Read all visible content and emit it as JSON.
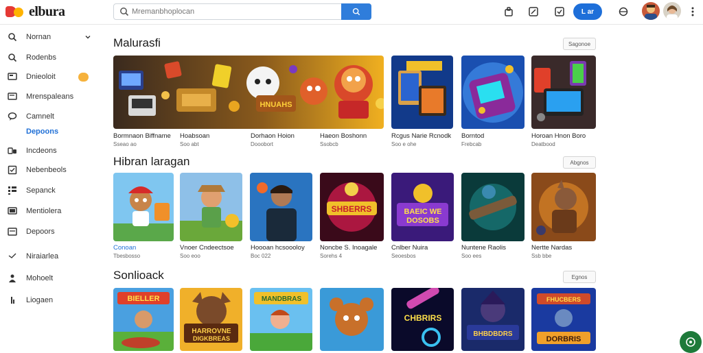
{
  "header": {
    "logo_text": "elbura",
    "search_placeholder": "Mremanbhoplocan",
    "pill_label": "L ar"
  },
  "sidebar": {
    "items": [
      {
        "label": "Nornan",
        "icon": "search-icon"
      },
      {
        "label": "Rodenbs",
        "icon": "gear-icon"
      },
      {
        "label": "Dnieoloit",
        "icon": "monitor-icon"
      },
      {
        "label": "Mrenspaleans",
        "icon": "monitor-icon"
      },
      {
        "label": "Camnelt",
        "icon": "chat-icon"
      },
      {
        "label": "Depoons",
        "icon": ""
      },
      {
        "label": "Incdeons",
        "icon": "sliders-icon"
      },
      {
        "label": "Nebenbeols",
        "icon": "checkbox-icon"
      },
      {
        "label": "Sepanck",
        "icon": "grid-icon"
      },
      {
        "label": "Mentiolera",
        "icon": "monitor-icon"
      },
      {
        "label": "Depoors",
        "icon": "list-icon"
      },
      {
        "label": "Niraiarlea",
        "icon": "signal-icon"
      },
      {
        "label": "Mohoelt",
        "icon": "user-icon"
      },
      {
        "label": "Liogaen",
        "icon": "bars-icon"
      }
    ]
  },
  "sections": [
    {
      "title": "Malurasfi",
      "see_all": "Sagonoe",
      "tiles": [
        {
          "name": "Bormnaon Biffname",
          "sub": "Sseao ao"
        },
        {
          "name": "Hoabsoan",
          "sub": "Soo abt"
        },
        {
          "name": "Dorhaon Hoion",
          "sub": "Dooobort"
        },
        {
          "name": "Haeon Boshonn",
          "sub": "Ssobcb"
        },
        {
          "name": "Rcgus Narie Rcnodk",
          "sub": "Soo e ohe"
        },
        {
          "name": "Borntod",
          "sub": "Frebcab"
        },
        {
          "name": "Horoan Hnon Boro",
          "sub": "Deatbood"
        }
      ]
    },
    {
      "title": "Hibran laragan",
      "see_all": "Abgnos",
      "tiles": [
        {
          "name": "Conoan",
          "sub": "Tbesbosso"
        },
        {
          "name": "Vnoer Cndeectsoe",
          "sub": "Soo eoo"
        },
        {
          "name": "Hoooan hcsoooloy",
          "sub": "Boc 022"
        },
        {
          "name": "Noncbe S. Inoagale",
          "sub": "Sorehs 4"
        },
        {
          "name": "Cnlber Nuira",
          "sub": "Seoesbos"
        },
        {
          "name": "Nuntene Raolis",
          "sub": "Soo ees"
        },
        {
          "name": "Nertte Nardas",
          "sub": "Ssb bbe"
        }
      ]
    },
    {
      "title": "Sonlioack",
      "see_all": "Egnos",
      "tiles": [
        {},
        {},
        {},
        {},
        {},
        {},
        {}
      ]
    }
  ],
  "colors": {
    "accent": "#2f7ddb",
    "pill": "#1e6fd9",
    "badge": "#f6b23c",
    "active_link": "#1f6fd6",
    "fab": "#1e7a3a"
  }
}
